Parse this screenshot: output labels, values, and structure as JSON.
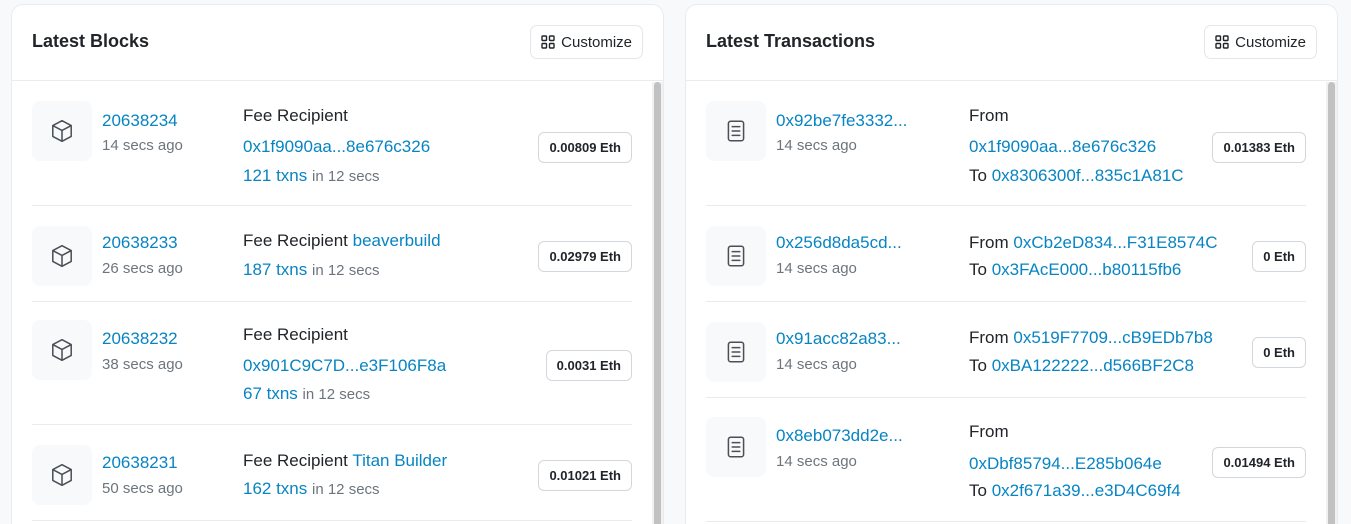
{
  "blocks": {
    "title": "Latest Blocks",
    "customize_label": "Customize",
    "items": [
      {
        "number": "20638234",
        "age": "14 secs ago",
        "fee_label": "Fee Recipient",
        "fee_recipient": "0x1f9090aa...8e676c326",
        "txns": "121 txns",
        "in_secs": "in 12 secs",
        "reward": "0.00809 Eth"
      },
      {
        "number": "20638233",
        "age": "26 secs ago",
        "fee_label": "Fee Recipient",
        "fee_recipient": "beaverbuild",
        "txns": "187 txns",
        "in_secs": "in 12 secs",
        "reward": "0.02979 Eth"
      },
      {
        "number": "20638232",
        "age": "38 secs ago",
        "fee_label": "Fee Recipient",
        "fee_recipient": "0x901C9C7D...e3F106F8a",
        "txns": "67 txns",
        "in_secs": "in 12 secs",
        "reward": "0.0031 Eth"
      },
      {
        "number": "20638231",
        "age": "50 secs ago",
        "fee_label": "Fee Recipient",
        "fee_recipient": "Titan Builder",
        "txns": "162 txns",
        "in_secs": "in 12 secs",
        "reward": "0.01021 Eth"
      }
    ]
  },
  "transactions": {
    "title": "Latest Transactions",
    "customize_label": "Customize",
    "items": [
      {
        "hash": "0x92be7fe3332...",
        "age": "14 secs ago",
        "from_label": "From",
        "from": "0x1f9090aa...8e676c326",
        "to_label": "To",
        "to": "0x8306300f...835c1A81C",
        "value": "0.01383 Eth"
      },
      {
        "hash": "0x256d8da5cd...",
        "age": "14 secs ago",
        "from_label": "From",
        "from": "0xCb2eD834...F31E8574C",
        "to_label": "To",
        "to": "0x3FAcE000...b80115fb6",
        "value": "0 Eth"
      },
      {
        "hash": "0x91acc82a83...",
        "age": "14 secs ago",
        "from_label": "From",
        "from": "0x519F7709...cB9EDb7b8",
        "to_label": "To",
        "to": "0xBA122222...d566BF2C8",
        "value": "0 Eth"
      },
      {
        "hash": "0x8eb073dd2e...",
        "age": "14 secs ago",
        "from_label": "From",
        "from": "0xDbf85794...E285b064e",
        "to_label": "To",
        "to": "0x2f671a39...e3D4C69f4",
        "value": "0.01494 Eth"
      }
    ]
  },
  "icons": {
    "customize": "grid-icon",
    "block": "cube-icon",
    "transaction": "document-icon"
  },
  "colors": {
    "link": "#0784c3",
    "muted": "#6c757d",
    "tile_bg": "#f8f9fa"
  }
}
